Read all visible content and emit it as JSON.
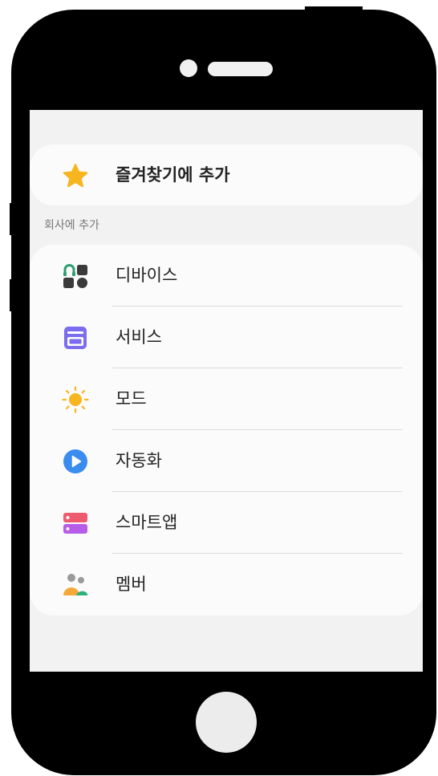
{
  "favorites": {
    "label": "즐겨찾기에 추가",
    "icon": "star-icon",
    "color": "#F7B520"
  },
  "section": {
    "title": "회사에 추가"
  },
  "menu": [
    {
      "label": "디바이스",
      "icon": "devices-icon",
      "color": "#2E9E6E"
    },
    {
      "label": "서비스",
      "icon": "service-icon",
      "color": "#7B6CF0"
    },
    {
      "label": "모드",
      "icon": "sun-icon",
      "color": "#F7B520"
    },
    {
      "label": "자동화",
      "icon": "play-icon",
      "color": "#3A8DEE"
    },
    {
      "label": "스마트앱",
      "icon": "smartapp-icon",
      "color": "#E9567A"
    },
    {
      "label": "멤버",
      "icon": "members-icon",
      "color": "#F4A93A"
    }
  ]
}
